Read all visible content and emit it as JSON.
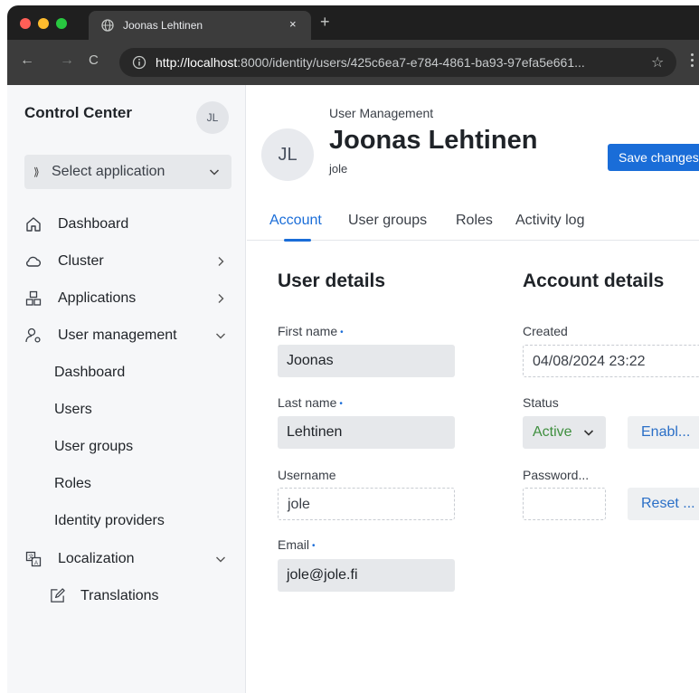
{
  "browser": {
    "tab_title": "Joonas Lehtinen",
    "tab_close": "×",
    "new_tab": "+",
    "url_host": "http://localhost",
    "url_path": ":8000/identity/users/425c6ea7-e784-4861-ba93-97efa5e661...",
    "nav_back": "←",
    "nav_forward": "→",
    "nav_reload": "C",
    "star": "☆"
  },
  "sidebar": {
    "brand": "Control Center",
    "user_initials": "JL",
    "app_select": {
      "icon": "⟫",
      "label": "Select application"
    },
    "items": [
      {
        "label": "Dashboard",
        "icon": "home-icon"
      },
      {
        "label": "Cluster",
        "icon": "cloud-icon"
      },
      {
        "label": "Applications",
        "icon": "applications-icon"
      },
      {
        "label": "User management",
        "icon": "user-settings-icon"
      },
      {
        "label": "Localization",
        "icon": "translate-icon"
      }
    ],
    "user_management_sub": [
      "Dashboard",
      "Users",
      "User groups",
      "Roles",
      "Identity providers"
    ],
    "localization_sub": [
      {
        "label": "Translations",
        "icon": "edit-icon"
      }
    ]
  },
  "header": {
    "breadcrumb": "User Management",
    "avatar_initials": "JL",
    "title": "Joonas Lehtinen",
    "subtitle": "jole",
    "save_label": "Save changes"
  },
  "tabs": [
    "Account",
    "User groups",
    "Roles",
    "Activity log"
  ],
  "user_details": {
    "title": "User details",
    "first_name": {
      "label": "First name",
      "value": "Joonas"
    },
    "last_name": {
      "label": "Last name",
      "value": "Lehtinen"
    },
    "username": {
      "label": "Username",
      "value": "jole"
    },
    "email": {
      "label": "Email",
      "value": "jole@jole.fi"
    }
  },
  "account_details": {
    "title": "Account details",
    "created": {
      "label": "Created",
      "value": "04/08/2024 23:22"
    },
    "status": {
      "label": "Status",
      "value": "Active",
      "action": "Enabl..."
    },
    "password": {
      "label": "Password...",
      "value": "",
      "action": "Reset ..."
    }
  },
  "required_marker": "•",
  "colors": {
    "accent": "#1a6dd8",
    "status_active": "#3f8f3f"
  }
}
